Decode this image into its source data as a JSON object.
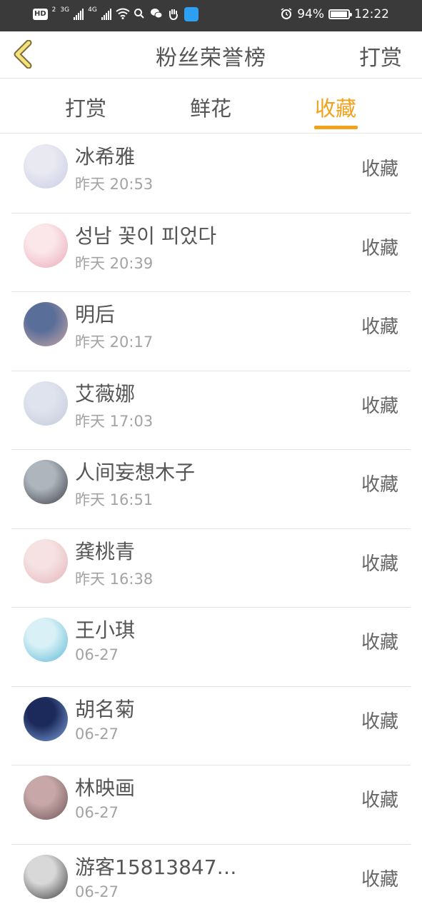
{
  "status_bar": {
    "hd_badge": "HD",
    "sim_badge": "2",
    "network_1": "3G",
    "network_2": "4G",
    "battery_percent": "94%",
    "battery_level": 0.94,
    "time": "12:22"
  },
  "header": {
    "title": "粉丝荣誉榜",
    "action_label": "打赏"
  },
  "tabs": [
    {
      "label": "打赏",
      "active": false
    },
    {
      "label": "鲜花",
      "active": false
    },
    {
      "label": "收藏",
      "active": true
    }
  ],
  "accent_color": "#f0a21c",
  "list": [
    {
      "name": "冰希雅",
      "time": "昨天 20:53",
      "action": "收藏",
      "avatar_colors": [
        "#e9e9f2",
        "#c9cbe4"
      ]
    },
    {
      "name": "성남 꽃이 피었다",
      "time": "昨天 20:39",
      "action": "收藏",
      "avatar_colors": [
        "#fbe6ea",
        "#e9a9b8"
      ]
    },
    {
      "name": "明后",
      "time": "昨天 20:17",
      "action": "收藏",
      "avatar_colors": [
        "#5a6e9a",
        "#c9a7a5"
      ]
    },
    {
      "name": "艾薇娜",
      "time": "昨天 17:03",
      "action": "收藏",
      "avatar_colors": [
        "#dfe3ee",
        "#c4cadb"
      ]
    },
    {
      "name": "人间妄想木子",
      "time": "昨天 16:51",
      "action": "收藏",
      "avatar_colors": [
        "#aeb5bd",
        "#3d4048"
      ]
    },
    {
      "name": "龚桃青",
      "time": "昨天 16:38",
      "action": "收藏",
      "avatar_colors": [
        "#f6e2e3",
        "#e3b4b8"
      ]
    },
    {
      "name": "王小琪",
      "time": "06-27",
      "action": "收藏",
      "avatar_colors": [
        "#d9f1f6",
        "#5bb8d6"
      ]
    },
    {
      "name": "胡名菊",
      "time": "06-27",
      "action": "收藏",
      "avatar_colors": [
        "#1b2a5a",
        "#7fa2e0"
      ]
    },
    {
      "name": "林映画",
      "time": "06-27",
      "action": "收藏",
      "avatar_colors": [
        "#c7a7a8",
        "#6e5556"
      ]
    },
    {
      "name": "游客15813847…",
      "time": "06-27",
      "action": "收藏",
      "avatar_colors": [
        "#d8d8d8",
        "#3a3a3a"
      ]
    }
  ]
}
